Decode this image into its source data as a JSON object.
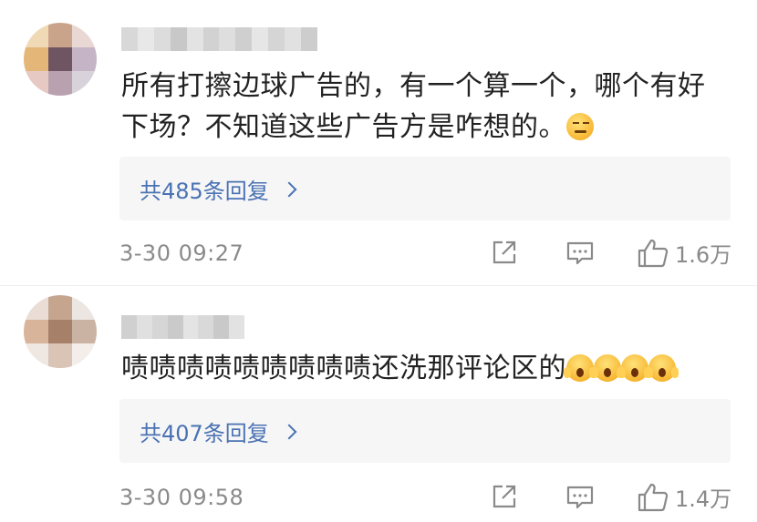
{
  "comments": [
    {
      "text": "所有打擦边球广告的，有一个算一个，哪个有好下场？不知道这些广告方是咋想的。",
      "emojis": [
        "smirk-emoji"
      ],
      "replies_label": "共485条回复",
      "timestamp": "3-30 09:27",
      "likes": "1.6万",
      "avatar_colors": [
        "#f0d9b5",
        "#c9a48a",
        "#e8d7d3",
        "#e4b779",
        "#6e5561",
        "#c5b3c6",
        "#e7c9c3",
        "#b9a1b0",
        "#d8d3db"
      ],
      "username_colors": [
        "#d8d8d8",
        "#e8e8e8",
        "#dcdcdc",
        "#c8c8c8",
        "#e3e3e3",
        "#d2d2d2",
        "#dedede",
        "#cfcfcf",
        "#e6e6e6",
        "#d5d5d5",
        "#e1e1e1",
        "#cdcdcd"
      ]
    },
    {
      "text": "啧啧啧啧啧啧啧啧啧还洗那评论区的",
      "emojis": [
        "scream-emoji",
        "scream-emoji",
        "scream-emoji",
        "scream-emoji"
      ],
      "replies_label": "共407条回复",
      "timestamp": "3-30 09:58",
      "likes": "1.4万",
      "avatar_colors": [
        "#e9ddd5",
        "#c6a58f",
        "#ece6e2",
        "#d8b59a",
        "#a68068",
        "#cbb3a3",
        "#efe7e1",
        "#d9c4b6",
        "#f3eeea"
      ],
      "username_colors": [
        "#d0d0d0",
        "#e0e0e0",
        "#d6d6d6",
        "#cacaca",
        "#e4e4e4",
        "#d9d9d9",
        "#c9c9c9",
        "#e2e2e2"
      ]
    }
  ],
  "icons": {
    "share": "share-icon",
    "comment": "comment-icon",
    "like": "like-icon"
  },
  "colors": {
    "link": "#4a72b3",
    "meta": "#8a8a8a",
    "reply_bg": "#f6f6f6"
  }
}
